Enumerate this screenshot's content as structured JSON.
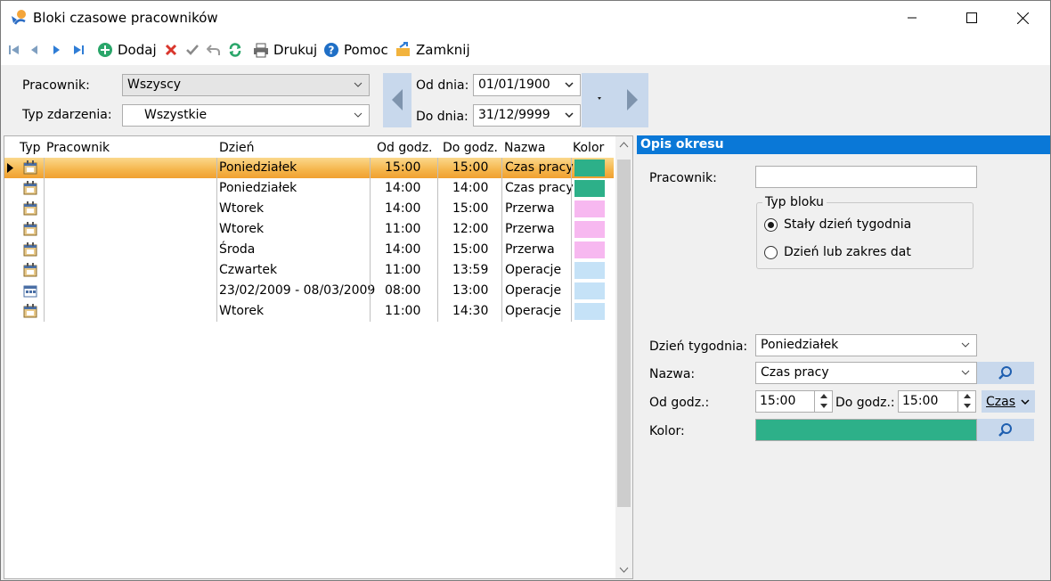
{
  "window": {
    "title": "Bloki czasowe pracowników"
  },
  "toolbar": {
    "add_label": "Dodaj",
    "print_label": "Drukuj",
    "help_label": "Pomoc",
    "close_label": "Zamknij"
  },
  "filters": {
    "employee_label": "Pracownik:",
    "employee_value": "Wszyscy",
    "event_type_label": "Typ zdarzenia:",
    "event_type_value": "Wszystkie",
    "from_label": "Od dnia:",
    "from_value": "01/01/1900",
    "to_label": "Do dnia:",
    "to_value": "31/12/9999"
  },
  "grid": {
    "columns": [
      "Typ",
      "Pracownik",
      "Dzień",
      "Od godz.",
      "Do godz.",
      "Nazwa",
      "Kolor"
    ],
    "rows": [
      {
        "pracownik": "",
        "dzien": "Poniedziałek",
        "od": "15:00",
        "do": "15:00",
        "nazwa": "Czas pracy",
        "kolor": "#2db089",
        "icon": "calendar-icon"
      },
      {
        "pracownik": "",
        "dzien": "Poniedziałek",
        "od": "14:00",
        "do": "14:00",
        "nazwa": "Czas pracy",
        "kolor": "#2db089",
        "icon": "calendar-icon"
      },
      {
        "pracownik": "",
        "dzien": "Wtorek",
        "od": "14:00",
        "do": "15:00",
        "nazwa": "Przerwa",
        "kolor": "#f7b8f0",
        "icon": "calendar-icon"
      },
      {
        "pracownik": "",
        "dzien": "Wtorek",
        "od": "11:00",
        "do": "12:00",
        "nazwa": "Przerwa",
        "kolor": "#f7b8f0",
        "icon": "calendar-icon"
      },
      {
        "pracownik": "",
        "dzien": "Środa",
        "od": "14:00",
        "do": "15:00",
        "nazwa": "Przerwa",
        "kolor": "#f7b8f0",
        "icon": "calendar-icon"
      },
      {
        "pracownik": "",
        "dzien": "Czwartek",
        "od": "11:00",
        "do": "13:59",
        "nazwa": "Operacje",
        "kolor": "#c5e2f7",
        "icon": "calendar-icon"
      },
      {
        "pracownik": "",
        "dzien": "23/02/2009 - 08/03/2009",
        "od": "08:00",
        "do": "13:00",
        "nazwa": "Operacje",
        "kolor": "#c5e2f7",
        "icon": "calendar-range-icon"
      },
      {
        "pracownik": "",
        "dzien": "Wtorek",
        "od": "11:00",
        "do": "14:30",
        "nazwa": "Operacje",
        "kolor": "#c5e2f7",
        "icon": "calendar-icon"
      }
    ]
  },
  "opis": {
    "header": "Opis okresu",
    "employee_label": "Pracownik:",
    "employee_value": "",
    "block_type_label": "Typ bloku",
    "radio_fixed": "Stały dzień tygodnia",
    "radio_range": "Dzień lub zakres dat",
    "weekday_label": "Dzień tygodnia:",
    "weekday_value": "Poniedziałek",
    "name_label": "Nazwa:",
    "name_value": "Czas pracy",
    "from_label": "Od godz.:",
    "from_value": "15:00",
    "to_label": "Do godz.:",
    "to_value": "15:00",
    "unit_label": "Czas",
    "color_label": "Kolor:",
    "color_value": "#2db089"
  }
}
